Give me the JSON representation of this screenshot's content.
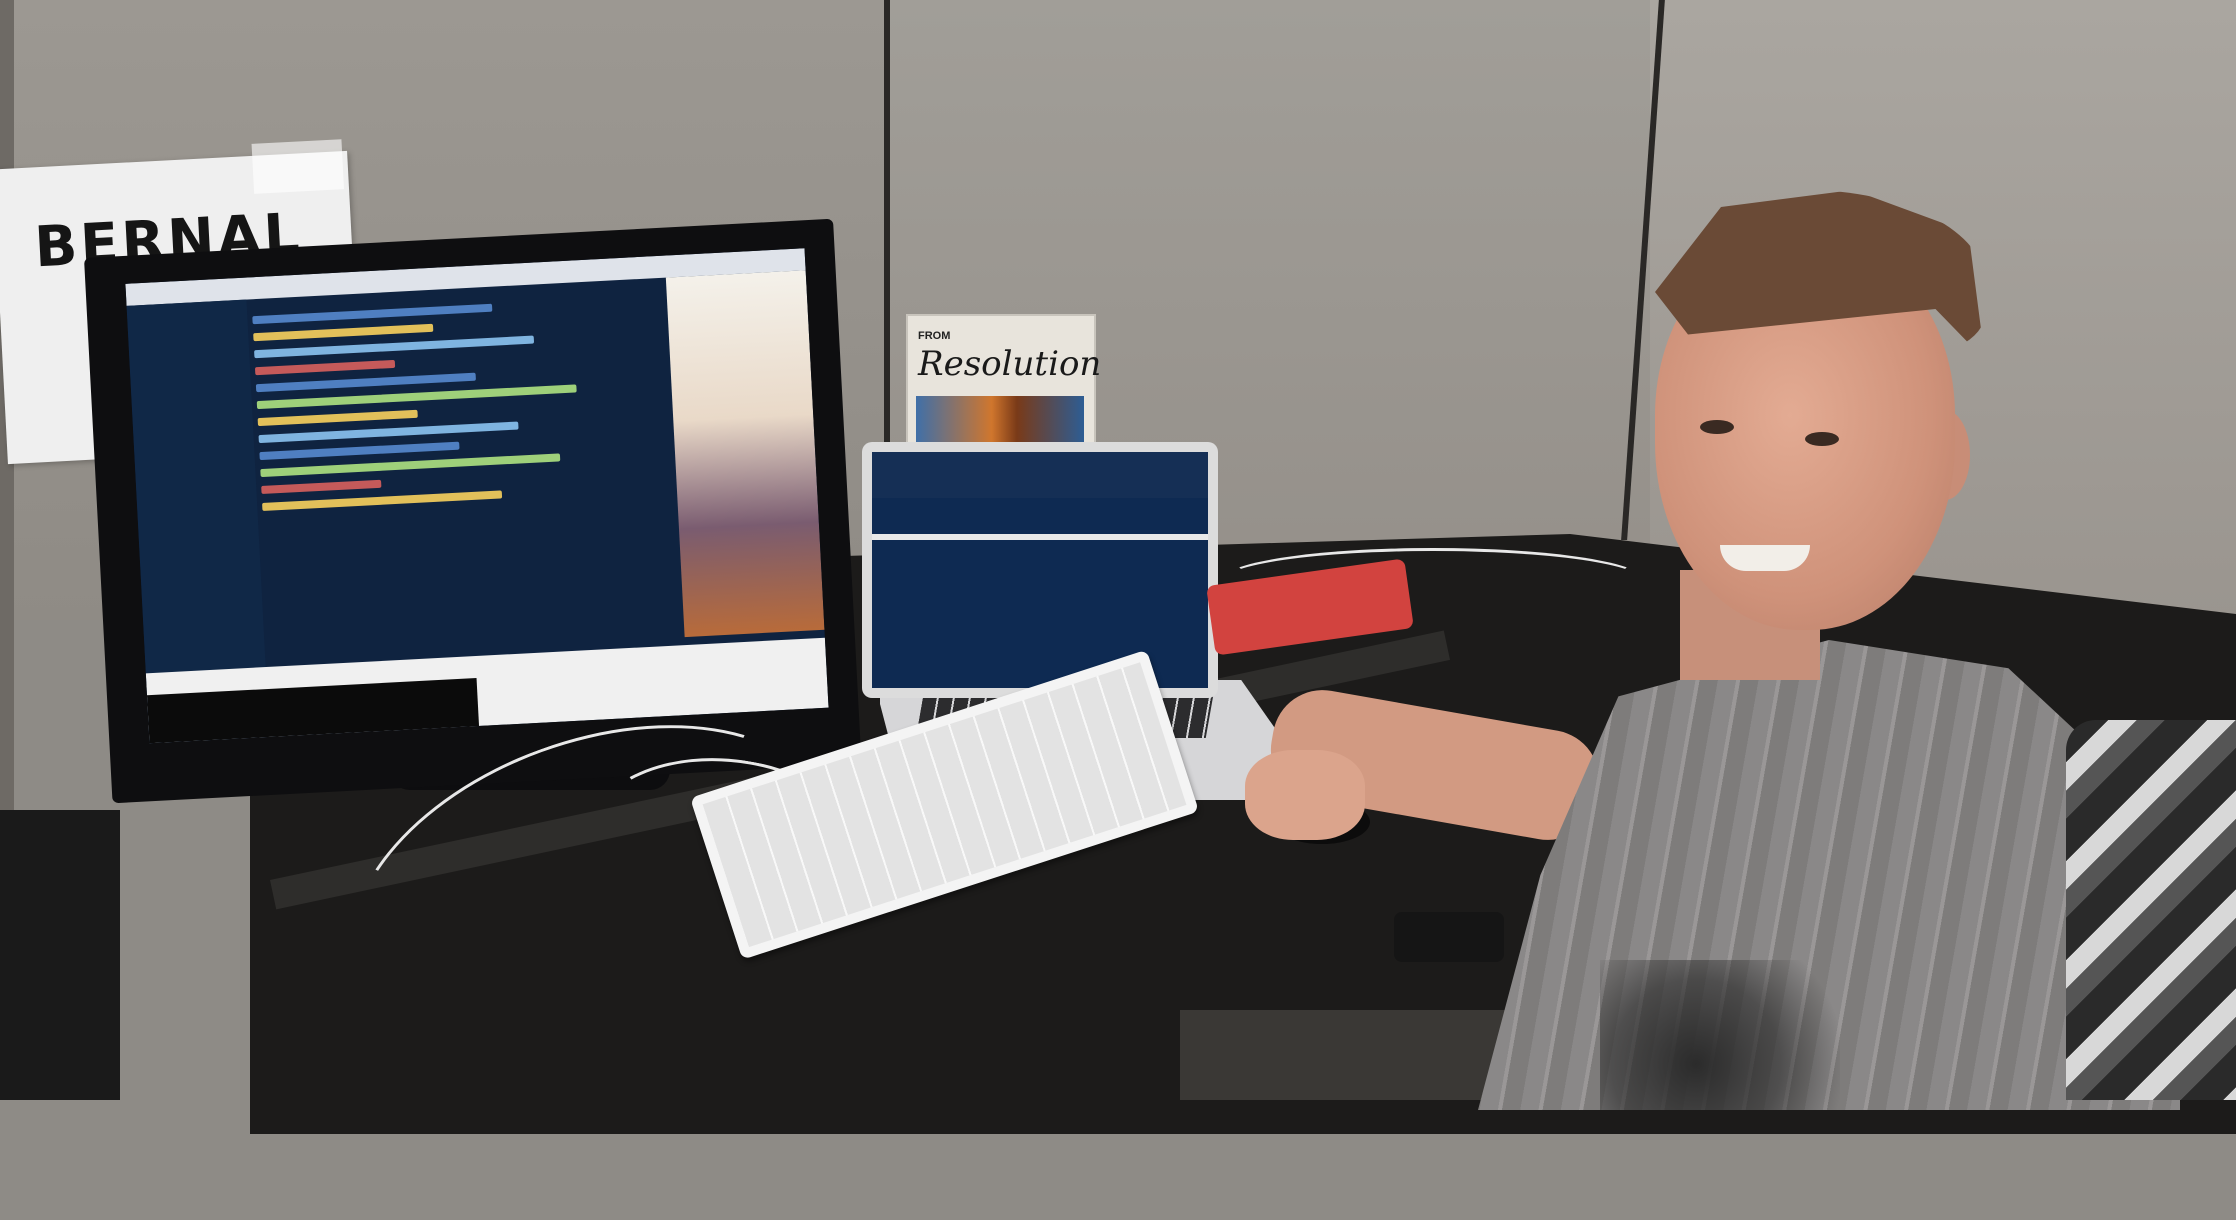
{
  "scene": {
    "name_card_text": "BERNAL",
    "poster_small_text": "FROM",
    "poster_title": "Resolution"
  },
  "colors": {
    "wall": "#9c9892",
    "desk": "#1c1b1a",
    "screen": "#0f2340",
    "mousepad": "#d2433f",
    "skin": "#d29a82"
  }
}
